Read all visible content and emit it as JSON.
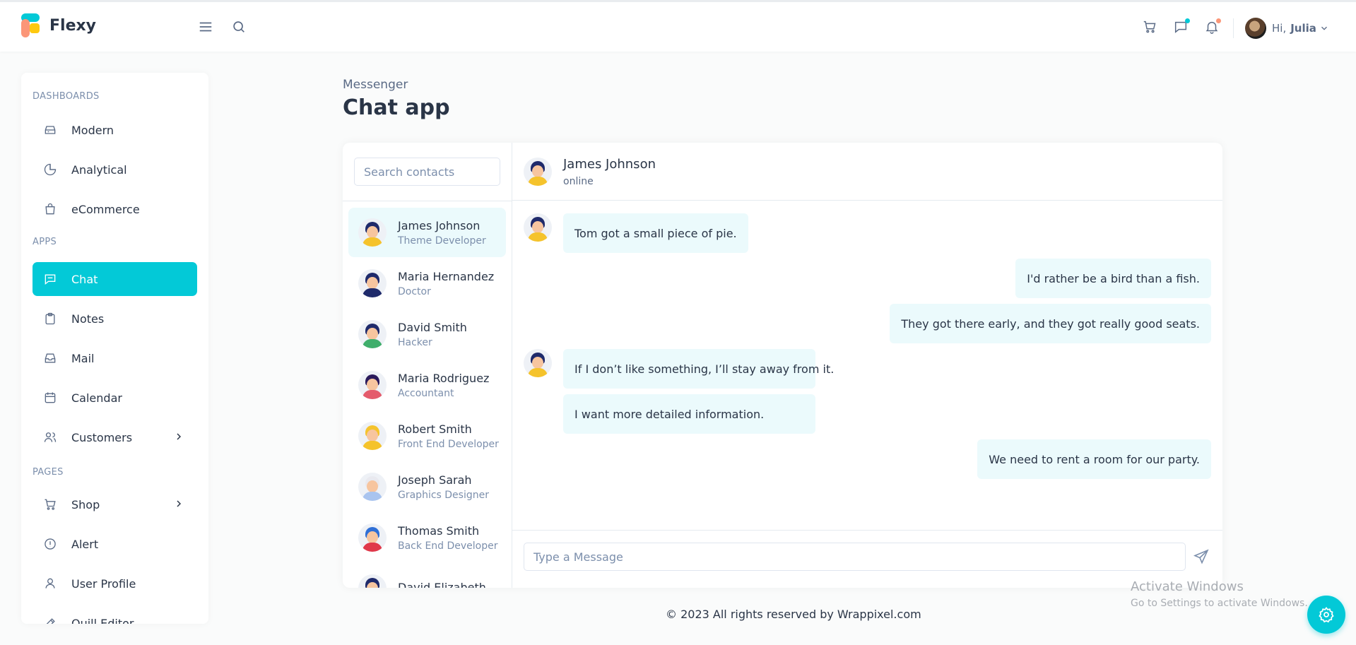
{
  "brand": {
    "name": "Flexy",
    "accent": "#03c9d7"
  },
  "topbar": {
    "icons": [
      "menu-icon",
      "search-icon",
      "cart-icon",
      "chat-icon",
      "bell-icon",
      "chevron-down-icon"
    ],
    "greeting": "Hi,",
    "user_name": "Julia"
  },
  "sidebar": {
    "sections": [
      {
        "caption": "Dashboards",
        "items": [
          {
            "label": "Modern",
            "icon": "dashboard-icon"
          },
          {
            "label": "Analytical",
            "icon": "pie-chart-icon"
          },
          {
            "label": "eCommerce",
            "icon": "shopping-bag-icon"
          }
        ]
      },
      {
        "caption": "Apps",
        "items": [
          {
            "label": "Chat",
            "icon": "message-icon",
            "active": true
          },
          {
            "label": "Notes",
            "icon": "clipboard-icon"
          },
          {
            "label": "Mail",
            "icon": "inbox-icon"
          },
          {
            "label": "Calendar",
            "icon": "calendar-icon"
          },
          {
            "label": "Customers",
            "icon": "users-icon",
            "has_children": true
          }
        ]
      },
      {
        "caption": "Pages",
        "items": [
          {
            "label": "Shop",
            "icon": "cart-icon",
            "has_children": true
          },
          {
            "label": "Alert",
            "icon": "alert-circle-icon"
          },
          {
            "label": "User Profile",
            "icon": "user-icon"
          },
          {
            "label": "Quill Editor",
            "icon": "edit-icon"
          }
        ]
      }
    ]
  },
  "header": {
    "breadcrumb": "Messenger",
    "title": "Chat app"
  },
  "contacts": {
    "search_placeholder": "Search contacts",
    "list": [
      {
        "name": "James Johnson",
        "role": "Theme Developer",
        "selected": true,
        "hair": "#1f2a6b",
        "shirt": "#f5c32c"
      },
      {
        "name": "Maria Hernandez",
        "role": "Doctor",
        "hair": "#1f2a6b",
        "shirt": "#1f2a6b"
      },
      {
        "name": "David Smith",
        "role": "Hacker",
        "hair": "#1f2a6b",
        "shirt": "#3fae6b"
      },
      {
        "name": "Maria Rodriguez",
        "role": "Accountant",
        "hair": "#2b1a5b",
        "shirt": "#e45b6c"
      },
      {
        "name": "Robert Smith",
        "role": "Front End Developer",
        "hair": "#f5c32c",
        "shirt": "#f5c32c"
      },
      {
        "name": "Joseph Sarah",
        "role": "Graphics Designer",
        "hair": "#e9e9ef",
        "shirt": "#a9c4ef"
      },
      {
        "name": "Thomas Smith",
        "role": "Back End Developer",
        "hair": "#2f6fd6",
        "shirt": "#e0384a"
      },
      {
        "name": "David Elizabeth",
        "role": "",
        "hair": "#1f2a6b",
        "shirt": "#f5c32c"
      }
    ]
  },
  "chat": {
    "contact_name": "James Johnson",
    "status": "online",
    "messages": [
      {
        "from": "them",
        "text": "Tom got a small piece of pie."
      },
      {
        "from": "me",
        "text": "I'd rather be a bird than a fish."
      },
      {
        "from": "me",
        "text": "They got there early, and they got really good seats."
      },
      {
        "from": "them",
        "text": "If I don’t like something, I’ll stay away from it."
      },
      {
        "from": "them",
        "text": "I want more detailed information."
      },
      {
        "from": "me",
        "text": "We need to rent a room for our party."
      }
    ],
    "input_placeholder": "Type a Message"
  },
  "footer": {
    "text": "© 2023 All rights reserved by Wrappixel.com"
  },
  "watermark": {
    "line1": "Activate Windows",
    "line2": "Go to Settings to activate Windows."
  },
  "fab_icon": "settings-gear-icon"
}
